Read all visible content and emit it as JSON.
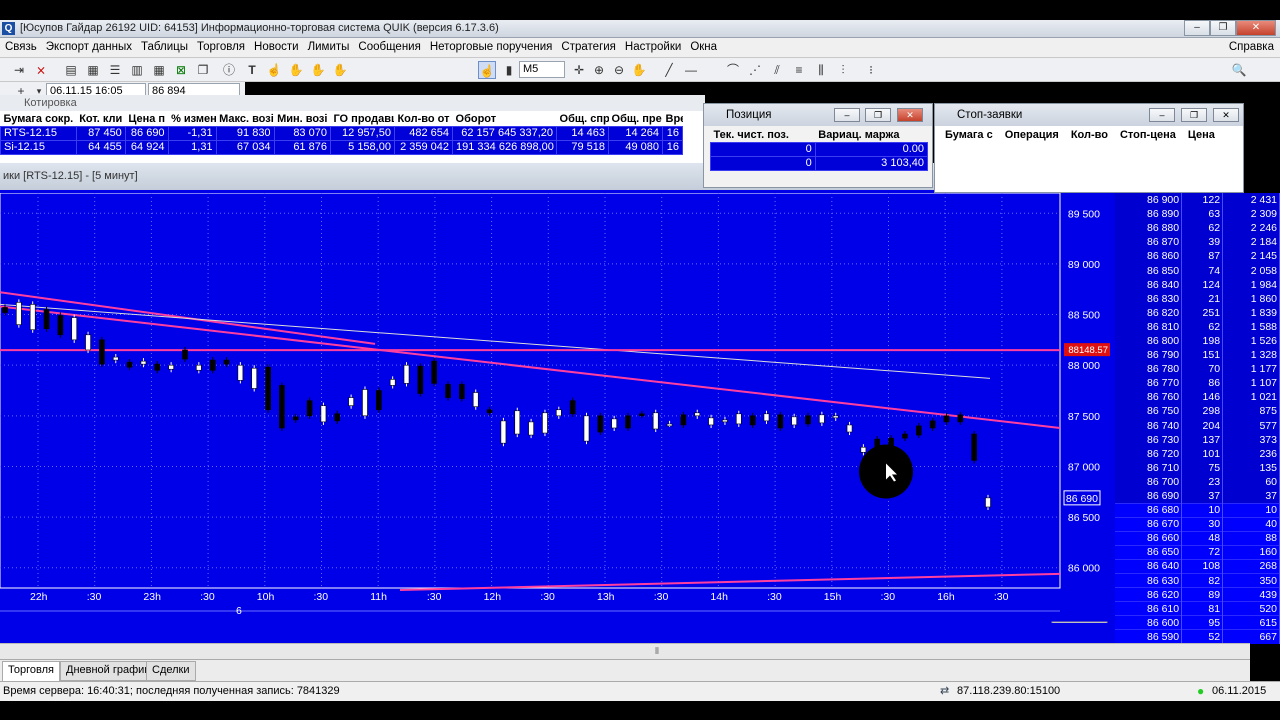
{
  "app": {
    "title": "[Юсупов Гайдар 26192 UID: 64153] Информационно-торговая система QUIK (версия 6.17.3.6)",
    "icon": "Q"
  },
  "menu": [
    "Связь",
    "Экспорт данных",
    "Таблицы",
    "Торговля",
    "Новости",
    "Лимиты",
    "Сообщения",
    "Неторговые поручения",
    "Стратегия",
    "Настройки",
    "Окна"
  ],
  "menu_right": "Справка",
  "toolbar": {
    "timeframe": "M5",
    "date": "06.11.15 16:05",
    "price": "86 894"
  },
  "quotes": {
    "title": "Котировка",
    "columns": [
      "Бумага сокр.",
      "Кот. кли",
      "Цена п",
      "% измен",
      "Макс. возі",
      "Мин. возі",
      "ГО продавц",
      "Кол-во от",
      "Оборот",
      "Общ. спр",
      "Общ. пре",
      "Вре"
    ],
    "rows": [
      [
        "RTS-12.15",
        "87 450",
        "86 690",
        "-1,31",
        "91 830",
        "83 070",
        "12 957,50",
        "482 654",
        "62 157 645 337,20",
        "14 463",
        "14 264",
        "16"
      ],
      [
        "Si-12.15",
        "64 455",
        "64 924",
        "1,31",
        "67 034",
        "61 876",
        "5 158,00",
        "2 359 042",
        "191 334 626 898,00",
        "79 518",
        "49 080",
        "16"
      ]
    ]
  },
  "position": {
    "title": "Позиция",
    "columns": [
      "Тек. чист. поз.",
      "Вариац. маржа"
    ],
    "rows": [
      [
        "0",
        "0.00"
      ],
      [
        "0",
        "3 103,40"
      ]
    ]
  },
  "stop_orders": {
    "title": "Стоп-заявки",
    "columns": [
      "Бумага с",
      "Операция",
      "Кол-во",
      "Стоп-цена",
      "Цена"
    ]
  },
  "chart": {
    "title": "ики [RTS-12.15] - [5 минут]",
    "price_label": "86 690",
    "line_label": "88148.57",
    "date_marker": "6",
    "y_ticks": [
      "89 500",
      "89 000",
      "88 500",
      "88 000",
      "87 500",
      "87 000",
      "86 500",
      "86 000"
    ],
    "x_ticks": [
      "22h",
      ":30",
      "23h",
      ":30",
      "10h",
      ":30",
      "11h",
      ":30",
      "12h",
      ":30",
      "13h",
      ":30",
      "14h",
      ":30",
      "15h",
      ":30",
      "16h",
      ":30"
    ]
  },
  "chart_data": {
    "type": "candlestick",
    "symbol": "RTS-12.15",
    "interval": "5 минут",
    "ylim": [
      85800,
      89700
    ],
    "ticks": [
      89500,
      89000,
      88500,
      88000,
      87500,
      87000,
      86500,
      86000
    ],
    "last_price": 86690,
    "hline": 88148.57,
    "candles": [
      88570,
      88520,
      88400,
      88620,
      88350,
      88600,
      88550,
      88360,
      88490,
      88300,
      88250,
      88470,
      88150,
      88300,
      88250,
      88010,
      88050,
      88080,
      88030,
      87980,
      88010,
      88040,
      88010,
      87950,
      87960,
      88000,
      88150,
      88060,
      87950,
      88000,
      88050,
      87950,
      88050,
      88010,
      87850,
      88000,
      87770,
      87970,
      87980,
      87560,
      87800,
      87380,
      87490,
      87460,
      87650,
      87500,
      87440,
      87600,
      87520,
      87450,
      87600,
      87680,
      87500,
      87760,
      87750,
      87560,
      87800,
      87860,
      87820,
      88000,
      87990,
      87720,
      88040,
      87820,
      87810,
      87680,
      87810,
      87670,
      87590,
      87730,
      87560,
      87530,
      87230,
      87450,
      87320,
      87550,
      87310,
      87440,
      87330,
      87530,
      87500,
      87560,
      87650,
      87520,
      87250,
      87500,
      87500,
      87340,
      87380,
      87470,
      87500,
      87380,
      87520,
      87510,
      87370,
      87530,
      87420,
      87420,
      87510,
      87410,
      87500,
      87530,
      87410,
      87480,
      87440,
      87460,
      87420,
      87520,
      87500,
      87410,
      87450,
      87520,
      87510,
      87380,
      87410,
      87490,
      87500,
      87420,
      87430,
      87510,
      87480,
      87500,
      87340,
      87410,
      87140,
      87190,
      87270,
      87140,
      87280,
      87200,
      87320,
      87280,
      87400,
      87310,
      87450,
      87380,
      87500,
      87440,
      87510,
      87440,
      87320,
      87060,
      86600,
      86690
    ]
  },
  "orderbook": {
    "asks": [
      [
        "86 900",
        "122",
        "2 431"
      ],
      [
        "86 890",
        "63",
        "2 309"
      ],
      [
        "86 880",
        "62",
        "2 246"
      ],
      [
        "86 870",
        "39",
        "2 184"
      ],
      [
        "86 860",
        "87",
        "2 145"
      ],
      [
        "86 850",
        "74",
        "2 058"
      ],
      [
        "86 840",
        "124",
        "1 984"
      ],
      [
        "86 830",
        "21",
        "1 860"
      ],
      [
        "86 820",
        "251",
        "1 839"
      ],
      [
        "86 810",
        "62",
        "1 588"
      ],
      [
        "86 800",
        "198",
        "1 526"
      ],
      [
        "86 790",
        "151",
        "1 328"
      ],
      [
        "86 780",
        "70",
        "1 177"
      ],
      [
        "86 770",
        "86",
        "1 107"
      ],
      [
        "86 760",
        "146",
        "1 021"
      ],
      [
        "86 750",
        "298",
        "875"
      ],
      [
        "86 740",
        "204",
        "577"
      ],
      [
        "86 730",
        "137",
        "373"
      ],
      [
        "86 720",
        "101",
        "236"
      ],
      [
        "86 710",
        "75",
        "135"
      ],
      [
        "86 700",
        "23",
        "60"
      ],
      [
        "86 690",
        "37",
        "37"
      ]
    ],
    "bids": [
      [
        "86 680",
        "10",
        "10"
      ],
      [
        "86 670",
        "30",
        "40"
      ],
      [
        "86 660",
        "48",
        "88"
      ],
      [
        "86 650",
        "72",
        "160"
      ],
      [
        "86 640",
        "108",
        "268"
      ],
      [
        "86 630",
        "82",
        "350"
      ],
      [
        "86 620",
        "89",
        "439"
      ],
      [
        "86 610",
        "81",
        "520"
      ],
      [
        "86 600",
        "95",
        "615"
      ],
      [
        "86 590",
        "52",
        "667"
      ]
    ]
  },
  "tabs": [
    "Торговля",
    "Дневной график",
    "Сделки"
  ],
  "status": {
    "server_time": "Время сервера: 16:40:31; последняя полученная запись: 7841329",
    "ip": "87.118.239.80:15100",
    "date": "06.11.2015"
  }
}
